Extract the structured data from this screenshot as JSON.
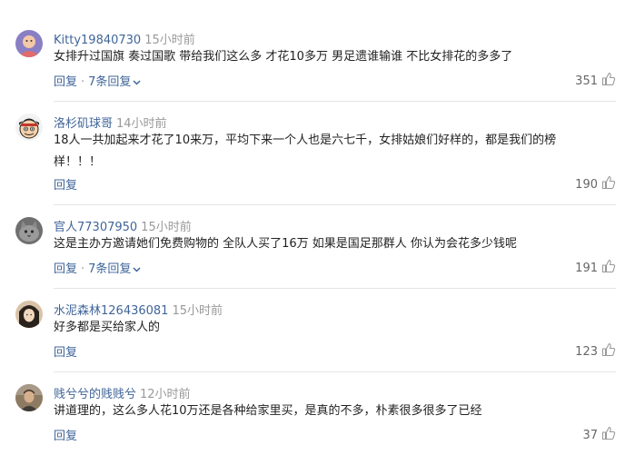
{
  "comments": [
    {
      "user": "Kitty19840730",
      "time": "15小时前",
      "text": "女排升过国旗 奏过国歌 带给我们这么多 才花10多万 男足遗谁输谁 不比女排花的多多了",
      "reply": "回复",
      "replies": "7条回复",
      "likes": "351",
      "avatar": "purple-cartoon-avatar"
    },
    {
      "user": "洛杉矶球哥",
      "time": "14小时前",
      "text": "18人一共加起来才花了10来万，平均下来一个人也是六七千，女排姑娘们好样的，都是我们的榜样！！！",
      "reply": "回复",
      "likes": "190",
      "avatar": "anime-face-avatar"
    },
    {
      "user": "官人77307950",
      "time": "15小时前",
      "text": "这是主办方邀请她们免费购物的 全队人买了16万 如果是国足那群人 你认为会花多少钱呢",
      "reply": "回复",
      "replies": "7条回复",
      "likes": "191",
      "avatar": "grey-cat-avatar"
    },
    {
      "user": "水泥森林126436081",
      "time": "15小时前",
      "text": "好多都是买给家人的",
      "reply": "回复",
      "likes": "123",
      "avatar": "dark-hair-avatar"
    },
    {
      "user": "贱兮兮的贱贱兮",
      "time": "12小时前",
      "text": "讲道理的，这么多人花10万还是各种给家里买，是真的不多，朴素很多很多了已经",
      "reply": "回复",
      "likes": "37",
      "avatar": "photo-avatar"
    }
  ],
  "colors": {
    "link": "#406599",
    "muted": "#999999",
    "text": "#222222",
    "divider": "#e5e5e5"
  }
}
